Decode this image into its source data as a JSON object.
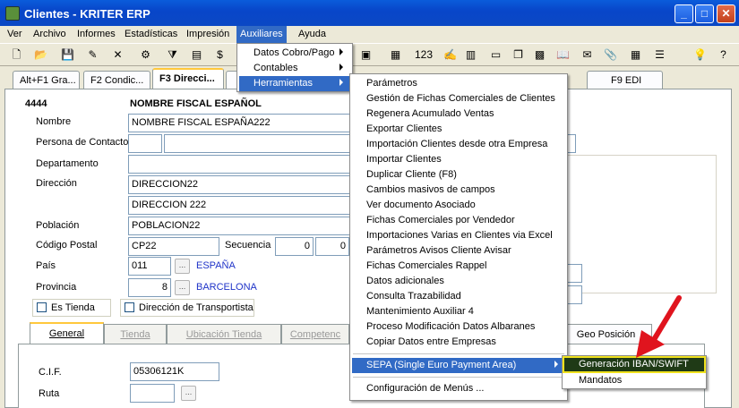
{
  "window": {
    "title": "Clientes - KRITER ERP",
    "buttons": [
      "_",
      "□",
      "✕"
    ]
  },
  "menubar": {
    "items": [
      "Ver",
      "Archivo",
      "Informes",
      "Estadísticas",
      "Impresión",
      "Auxiliares",
      "Ayuda"
    ]
  },
  "tabs": [
    "Alt+F1 Gra...",
    "F2 Condic...",
    "F3 Direcci...",
    "F9 EDI"
  ],
  "record": {
    "code": "4444",
    "name_display": "NOMBRE FISCAL ESPAÑOL"
  },
  "form": {
    "nombre_label": "Nombre",
    "nombre": "NOMBRE FISCAL ESPAÑA222",
    "contacto_label": "Persona de Contacto",
    "departamento_label": "Departamento",
    "direccion_label": "Dirección",
    "direccion1": "DIRECCION22",
    "direccion2": "DIRECCION 222",
    "poblacion_label": "Población",
    "poblacion": "POBLACION22",
    "cp_label": "Código Postal",
    "cp": "CP22",
    "secuencia_label": "Secuencia",
    "secuencia1": "0",
    "secuencia2": "0",
    "pais_label": "País",
    "pais_code": "011",
    "pais_name": "ESPAÑA",
    "provincia_label": "Provincia",
    "provincia_code": "8",
    "provincia_name": "BARCELONA",
    "es_tienda": "Es Tienda",
    "dir_transportista": "Dirección de Transportista"
  },
  "subtabs": [
    "General",
    "Tienda",
    "Ubicación Tienda",
    "Competenc",
    "Geo Posición"
  ],
  "general": {
    "cif_label": "C.I.F.",
    "cif": "05306121K",
    "ruta_label": "Ruta"
  },
  "auxiliares_menu": [
    "Datos Cobro/Pago",
    "Contables",
    "Herramientas"
  ],
  "herramientas_menu": [
    "Parámetros",
    "Gestión de Fichas Comerciales de Clientes",
    "Regenera Acumulado Ventas",
    "Exportar Clientes",
    "Importación Clientes desde otra Empresa",
    "Importar Clientes",
    "Duplicar Cliente (F8)",
    "Cambios masivos de campos",
    "Ver documento Asociado",
    "Fichas Comerciales por Vendedor",
    "Importaciones Varias en Clientes via Excel",
    "Parámetros Avisos Cliente Avisar",
    "Fichas Comerciales Rappel",
    "Datos adicionales",
    "Consulta Trazabilidad",
    "Mantenimiento Auxiliar 4",
    "Proceso Modificación Datos Albaranes",
    "Copiar Datos entre Empresas",
    "SEPA (Single Euro Payment Area)",
    "Configuración de Menús ..."
  ],
  "sepa_menu": [
    "Generación IBAN/SWIFT",
    "Mandatos"
  ],
  "colors": {
    "highlight": "#316AC5",
    "annotation": "#E0141E",
    "callout_border": "#F0E21E"
  }
}
